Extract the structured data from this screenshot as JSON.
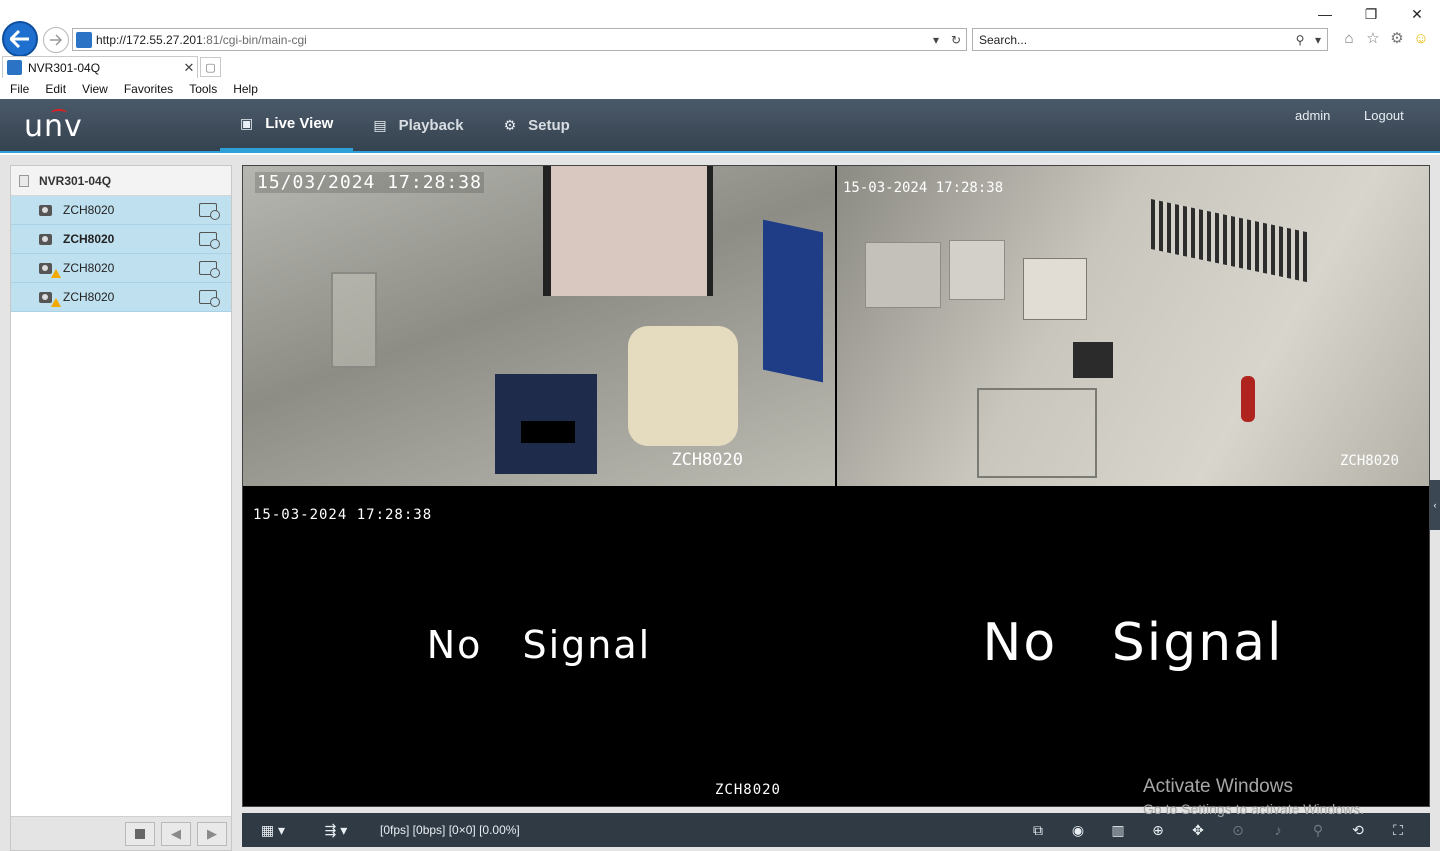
{
  "browser": {
    "url_host": "http://172.55.27.201",
    "url_rest": ":81/cgi-bin/main-cgi",
    "search_placeholder": "Search...",
    "tab_title": "NVR301-04Q",
    "menu": [
      "File",
      "Edit",
      "View",
      "Favorites",
      "Tools",
      "Help"
    ]
  },
  "app": {
    "logo": "unv",
    "nav": [
      {
        "label": "Live View",
        "icon": "monitor-icon",
        "active": true
      },
      {
        "label": "Playback",
        "icon": "film-icon",
        "active": false
      },
      {
        "label": "Setup",
        "icon": "gear-icon",
        "active": false
      }
    ],
    "user": "admin",
    "logout": "Logout"
  },
  "sidebar": {
    "device": "NVR301-04Q",
    "cameras": [
      {
        "name": "ZCH8020",
        "bold": false,
        "warning": false
      },
      {
        "name": "ZCH8020",
        "bold": true,
        "warning": false
      },
      {
        "name": "ZCH8020",
        "bold": false,
        "warning": true
      },
      {
        "name": "ZCH8020",
        "bold": false,
        "warning": true
      }
    ]
  },
  "panes": {
    "p1": {
      "timestamp": "15/03/2024 17:28:38",
      "name": "ZCH8020"
    },
    "p2": {
      "timestamp": "15-03-2024  17:28:38",
      "name": "ZCH8020"
    },
    "p3": {
      "timestamp": "15-03-2024  17:28:38",
      "name": "ZCH8020",
      "message": "No  Signal"
    },
    "p4": {
      "message": "No  Signal"
    }
  },
  "toolbar": {
    "status": "[0fps] [0bps] [0×0] [0.00%]"
  },
  "watermark": {
    "line1": "Activate Windows",
    "line2": "Go to Settings to activate Windows."
  }
}
